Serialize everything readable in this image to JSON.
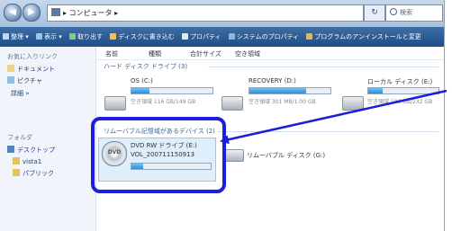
{
  "window": {
    "breadcrumb": [
      "コンピュータ"
    ],
    "search_placeholder": "検索",
    "back_label": "◀",
    "forward_label": "▶",
    "refresh_label": "↻"
  },
  "toolbar": {
    "items": [
      {
        "label": "整理 ▾",
        "icon": "organize-icon"
      },
      {
        "label": "表示 ▾",
        "icon": "views-icon"
      },
      {
        "label": "取り出す",
        "icon": "eject-icon"
      },
      {
        "label": "ディスクに書き込む",
        "icon": "burn-icon"
      },
      {
        "label": "プロパティ",
        "icon": "properties-icon"
      },
      {
        "label": "システムのプロパティ",
        "icon": "system-properties-icon"
      },
      {
        "label": "プログラムのアンインストールと変更",
        "icon": "uninstall-icon"
      }
    ]
  },
  "sidebar": {
    "favorites_header": "お気に入りリンク",
    "favorites": [
      {
        "label": "ドキュメント",
        "icon": "documents-icon"
      },
      {
        "label": "ピクチャ",
        "icon": "pictures-icon"
      },
      {
        "label": "詳細 »",
        "icon": ""
      }
    ],
    "folders_header": "フォルダ",
    "folders": [
      {
        "label": "デスクトップ",
        "icon": "desktop-icon"
      },
      {
        "label": "vista1",
        "icon": "user-folder-icon"
      },
      {
        "label": "パブリック",
        "icon": "public-folder-icon"
      }
    ]
  },
  "columns": [
    "名前",
    "種類",
    "合計サイズ",
    "空き領域"
  ],
  "groups": {
    "hdd_title": "ハード ディスク ドライブ (3)",
    "removable_title": "リムーバブル記憶域があるデバイス (2)"
  },
  "drives": {
    "c": {
      "name": "OS (C:)",
      "free_text": "空き領域 116 GB/149 GB",
      "used_fraction": 0.22
    },
    "d": {
      "name": "RECOVERY (D:)",
      "free_text": "空き領域 301 MB/1.00 GB",
      "used_fraction": 0.7
    },
    "local": {
      "name": "ローカル ディスク (E:)",
      "free_text": "空き領域 186 GB/232 GB",
      "used_fraction": 0.2
    },
    "dvd": {
      "name": "DVD RW ドライブ (E:)",
      "volume": "VOL_200711150913",
      "icon_text": "DVD",
      "used_fraction": 0.15
    },
    "removable": {
      "name": "リムーバブル ディスク (G:)"
    }
  },
  "colors": {
    "callout": "#1d1ddc",
    "toolbar": "#1f4d86",
    "usage_bar": "#2b8ed8"
  }
}
